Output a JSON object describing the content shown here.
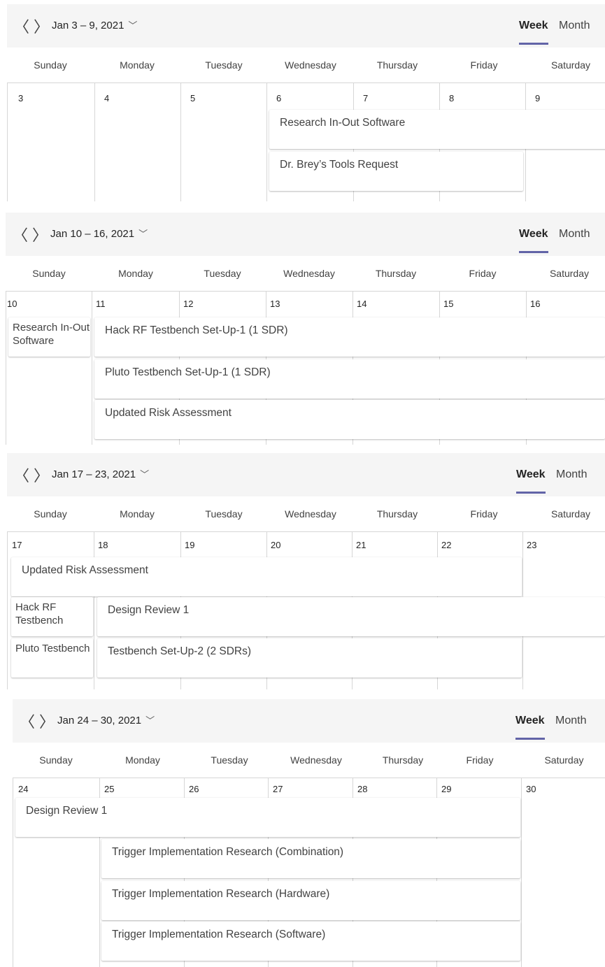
{
  "accent": "#6264a7",
  "nav": {
    "prev_icon": "chevron-left-icon",
    "next_icon": "chevron-right-icon",
    "dropdown_icon": "chevron-down-icon"
  },
  "tabs": {
    "week": "Week",
    "month": "Month"
  },
  "weeks": [
    {
      "range": "Jan 3 – 9, 2021",
      "days": [
        "Sunday",
        "Monday",
        "Tuesday",
        "Wednesday",
        "Thursday",
        "Friday",
        "Saturday"
      ],
      "dates": [
        "3",
        "4",
        "5",
        "6",
        "7",
        "8",
        "9"
      ],
      "events": [
        "Research In-Out Software",
        "Dr. Brey’s Tools Request"
      ]
    },
    {
      "range": "Jan 10 – 16, 2021",
      "days": [
        "Sunday",
        "Monday",
        "Tuesday",
        "Wednesday",
        "Thursday",
        "Friday",
        "Saturday"
      ],
      "dates": [
        "10",
        "11",
        "12",
        "13",
        "14",
        "15",
        "16"
      ],
      "events": [
        "Research In-Out Software",
        "Hack RF Testbench Set-Up-1 (1 SDR)",
        "Pluto Testbench Set-Up-1 (1 SDR)",
        "Updated Risk Assessment"
      ]
    },
    {
      "range": "Jan 17 – 23, 2021",
      "days": [
        "Sunday",
        "Monday",
        "Tuesday",
        "Wednesday",
        "Thursday",
        "Friday",
        "Saturday"
      ],
      "dates": [
        "17",
        "18",
        "19",
        "20",
        "21",
        "22",
        "23"
      ],
      "events": [
        "Updated Risk Assessment",
        "Hack RF Testbench",
        "Design Review 1",
        "Pluto Testbench",
        "Testbench Set-Up-2 (2 SDRs)"
      ]
    },
    {
      "range": "Jan 24 – 30, 2021",
      "days": [
        "Sunday",
        "Monday",
        "Tuesday",
        "Wednesday",
        "Thursday",
        "Friday",
        "Saturday"
      ],
      "dates": [
        "24",
        "25",
        "26",
        "27",
        "28",
        "29",
        "30"
      ],
      "events": [
        "Design Review 1",
        "Trigger Implementation Research (Combination)",
        "Trigger Implementation Research (Hardware)",
        "Trigger Implementation Research (Software)"
      ]
    }
  ]
}
